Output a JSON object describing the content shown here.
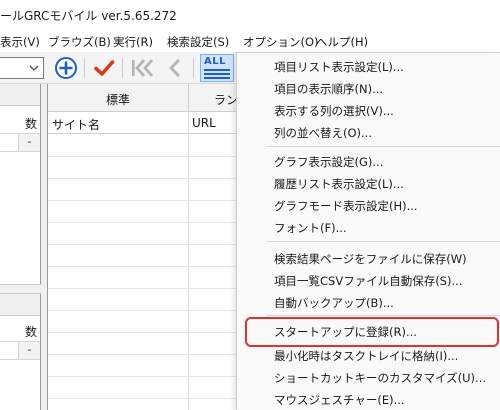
{
  "app": {
    "title": "ールGRCモバイル  ver.5.65.272"
  },
  "menubar": {
    "items": [
      "表示(V)",
      "ブラウズ(B)",
      "実行(R)",
      "検索設定(S)",
      "オプション(O)",
      "ヘルプ(H)"
    ]
  },
  "toolbar": {
    "combo_value": "",
    "all_label": "ALL",
    "icons": [
      "add-circle-icon",
      "checkmark-icon",
      "rewind-first-icon",
      "previous-icon",
      "all-list-icon"
    ],
    "colors": {
      "add": "#1f5fc0",
      "check": "#d93a1b",
      "disabled": "#b4b4b4",
      "accent": "#e0332f"
    }
  },
  "left_pane": {
    "top_header": "数",
    "top_cell": "-",
    "bottom_header": "数",
    "bottom_cell": "-"
  },
  "grid": {
    "group_header": "標準",
    "rank_header": "ラン",
    "columns": [
      "サイト名",
      "URL"
    ]
  },
  "options_menu": {
    "items": [
      "項目リスト表示設定(L)...",
      "項目の表示順序(N)...",
      "表示する列の選択(V)...",
      "列の並べ替え(O)...",
      "グラフ表示設定(G)...",
      "履歴リスト表示設定(L)...",
      "グラフモード表示設定(H)...",
      "フォント(F)...",
      "検索結果ページをファイルに保存(W)",
      "項目一覧CSVファイル自動保存(S)...",
      "自動バックアップ(B)...",
      "スタートアップに登録(R)...",
      "最小化時はタスクトレイに格納(I)...",
      "ショートカットキーのカスタマイズ(U)...",
      "マウスジェスチャー(E)..."
    ],
    "highlighted_index": 11
  }
}
